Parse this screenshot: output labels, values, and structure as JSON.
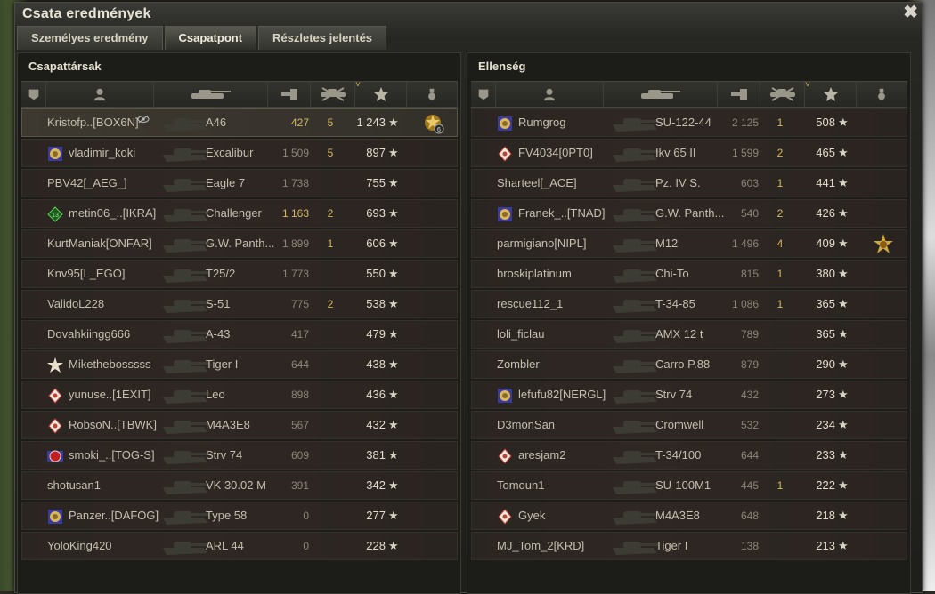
{
  "window": {
    "title": "Csata eredmények",
    "close_label": "✖"
  },
  "tabs": [
    {
      "label": "Személyes eredmény",
      "active": false
    },
    {
      "label": "Csapatpont",
      "active": true
    },
    {
      "label": "Részletes jelentés",
      "active": false
    }
  ],
  "columns": {
    "icons": [
      "platoon-icon",
      "player-icon",
      "tank-icon",
      "damage-icon",
      "kills-icon",
      "xp-star-icon",
      "medal-icon"
    ],
    "sort_indicator": "˅"
  },
  "star_glyph": "★",
  "teams": [
    {
      "title": "Csapattársak",
      "players": [
        {
          "name": "Kristofp..[BOX6N]",
          "badge": "none",
          "tank": "A46",
          "damage": "427",
          "kills": "5",
          "xp": "1 243",
          "medal": "medal-6",
          "me": true,
          "hidden": true,
          "dmg_hi": true
        },
        {
          "name": "vladimir_koki",
          "badge": "clan-gold",
          "tank": "Excalibur",
          "damage": "1 509",
          "kills": "5",
          "xp": "897",
          "medal": "",
          "dmg_hi": false
        },
        {
          "name": "PBV42[_AEG_]",
          "badge": "none",
          "tank": "Eagle 7",
          "damage": "1 738",
          "kills": "",
          "xp": "755",
          "medal": "",
          "dmg_hi": false
        },
        {
          "name": "metin06_..[IKRA]",
          "badge": "green-13",
          "tank": "Challenger",
          "damage": "1 163",
          "kills": "2",
          "xp": "693",
          "medal": "",
          "dmg_hi": true
        },
        {
          "name": "KurtManiak[ONFAR]",
          "badge": "none",
          "tank": "G.W. Panth...",
          "damage": "1 899",
          "kills": "1",
          "xp": "606",
          "medal": "",
          "dmg_hi": false
        },
        {
          "name": "Knv95[L_EGO]",
          "badge": "none",
          "tank": "T25/2",
          "damage": "1 773",
          "kills": "",
          "xp": "550",
          "medal": "",
          "dmg_hi": false
        },
        {
          "name": "ValidoL228",
          "badge": "none",
          "tank": "S-51",
          "damage": "775",
          "kills": "2",
          "xp": "538",
          "medal": "",
          "dmg_hi": false
        },
        {
          "name": "Dovahkiingg666",
          "badge": "none",
          "tank": "A-43",
          "damage": "417",
          "kills": "",
          "xp": "479",
          "medal": "",
          "dmg_hi": false
        },
        {
          "name": "Mikethebosssss",
          "badge": "star-white",
          "tank": "Tiger I",
          "damage": "644",
          "kills": "",
          "xp": "438",
          "medal": "",
          "dmg_hi": false
        },
        {
          "name": "yunuse..[1EXIT]",
          "badge": "diamond-red",
          "tank": "Leo",
          "damage": "898",
          "kills": "",
          "xp": "436",
          "medal": "",
          "dmg_hi": false
        },
        {
          "name": "RobsoN..[TBWK]",
          "badge": "diamond-red",
          "tank": "M4A3E8",
          "damage": "567",
          "kills": "",
          "xp": "432",
          "medal": "",
          "dmg_hi": false
        },
        {
          "name": "smoki_..[TOG-S]",
          "badge": "round-red",
          "tank": "Strv 74",
          "damage": "609",
          "kills": "",
          "xp": "381",
          "medal": "",
          "dmg_hi": false
        },
        {
          "name": "shotusan1",
          "badge": "none",
          "tank": "VK 30.02 M",
          "damage": "391",
          "kills": "",
          "xp": "342",
          "medal": "",
          "dmg_hi": false
        },
        {
          "name": "Panzer..[DAFOG]",
          "badge": "clan-gold",
          "tank": "Type 58",
          "damage": "0",
          "kills": "",
          "xp": "277",
          "medal": "",
          "dmg_hi": false
        },
        {
          "name": "YoloKing420",
          "badge": "none",
          "tank": "ARL 44",
          "damage": "0",
          "kills": "",
          "xp": "228",
          "medal": "",
          "dmg_hi": false
        }
      ]
    },
    {
      "title": "Ellenség",
      "players": [
        {
          "name": "Rumgrog",
          "badge": "clan-gold",
          "tank": "SU-122-44",
          "damage": "2 125",
          "kills": "1",
          "xp": "508",
          "medal": "",
          "dmg_hi": false
        },
        {
          "name": "FV4034[0PT0]",
          "badge": "diamond-red",
          "tank": "Ikv 65 II",
          "damage": "1 599",
          "kills": "2",
          "xp": "465",
          "medal": "",
          "dmg_hi": false
        },
        {
          "name": "Sharteel[_ACE]",
          "badge": "none",
          "tank": "Pz. IV S.",
          "damage": "603",
          "kills": "1",
          "xp": "441",
          "medal": "",
          "dmg_hi": false
        },
        {
          "name": "Franek_..[TNAD]",
          "badge": "clan-gold",
          "tank": "G.W. Panth...",
          "damage": "540",
          "kills": "2",
          "xp": "426",
          "medal": "",
          "dmg_hi": false
        },
        {
          "name": "parmigiano[NIPL]",
          "badge": "none",
          "tank": "M12",
          "damage": "1 496",
          "kills": "4",
          "xp": "409",
          "medal": "medal-gold",
          "dmg_hi": false
        },
        {
          "name": "broskiplatinum",
          "badge": "none",
          "tank": "Chi-To",
          "damage": "815",
          "kills": "1",
          "xp": "380",
          "medal": "",
          "dmg_hi": false
        },
        {
          "name": "rescue112_1",
          "badge": "none",
          "tank": "T-34-85",
          "damage": "1 086",
          "kills": "1",
          "xp": "365",
          "medal": "",
          "dmg_hi": false
        },
        {
          "name": "loli_ficlau",
          "badge": "none",
          "tank": "AMX 12 t",
          "damage": "789",
          "kills": "",
          "xp": "365",
          "medal": "",
          "dmg_hi": false
        },
        {
          "name": "Zombler",
          "badge": "none",
          "tank": "Carro P.88",
          "damage": "879",
          "kills": "",
          "xp": "290",
          "medal": "",
          "dmg_hi": false
        },
        {
          "name": "lefufu82[NERGL]",
          "badge": "clan-gold",
          "tank": "Strv 74",
          "damage": "432",
          "kills": "",
          "xp": "273",
          "medal": "",
          "dmg_hi": false
        },
        {
          "name": "D3monSan",
          "badge": "none",
          "tank": "Cromwell",
          "damage": "532",
          "kills": "",
          "xp": "234",
          "medal": "",
          "dmg_hi": false
        },
        {
          "name": "aresjam2",
          "badge": "diamond-red",
          "tank": "T-34/100",
          "damage": "644",
          "kills": "",
          "xp": "233",
          "medal": "",
          "dmg_hi": false
        },
        {
          "name": "Tomoun1",
          "badge": "none",
          "tank": "SU-100M1",
          "damage": "445",
          "kills": "1",
          "xp": "222",
          "medal": "",
          "dmg_hi": false
        },
        {
          "name": "Gyek",
          "badge": "diamond-red",
          "tank": "M4A3E8",
          "damage": "648",
          "kills": "",
          "xp": "218",
          "medal": "",
          "dmg_hi": false
        },
        {
          "name": "MJ_Tom_2[KRD]",
          "badge": "none",
          "tank": "Tiger I",
          "damage": "138",
          "kills": "",
          "xp": "213",
          "medal": "",
          "dmg_hi": false
        }
      ]
    }
  ]
}
